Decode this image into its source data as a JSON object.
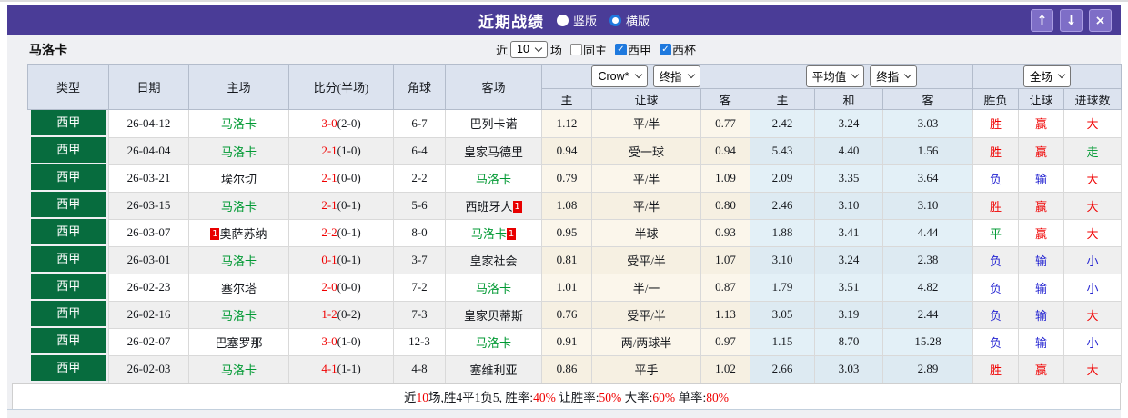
{
  "titlebar": {
    "title": "近期战绩",
    "radio_vertical": "竖版",
    "radio_horizontal": "横版",
    "selected_layout": "横版",
    "up_icon": "↑",
    "down_icon": "↓",
    "close_icon": "×"
  },
  "filterbar": {
    "team": "马洛卡",
    "recent_prefix": "近",
    "recent_value": "10",
    "recent_suffix": "场",
    "cb_same_home": "同主",
    "cb_same_home_checked": false,
    "cb_league": "西甲",
    "cb_league_checked": true,
    "cb_cup": "西杯",
    "cb_cup_checked": true,
    "check_icon": "✓"
  },
  "table": {
    "header": {
      "type": "类型",
      "date": "日期",
      "home": "主场",
      "score": "比分(半场)",
      "corner": "角球",
      "away": "客场",
      "select_crow": "Crow*",
      "select_final1": "终指",
      "select_avg": "平均值",
      "select_final2": "终指",
      "select_fulltime": "全场",
      "sub": [
        "主",
        "让球",
        "客",
        "主",
        "和",
        "客",
        "胜负",
        "让球",
        "进球数"
      ]
    },
    "rows": [
      {
        "league": "西甲",
        "date": "26-04-12",
        "home": "马洛卡",
        "home_color": "green",
        "home_badge_pre": "",
        "home_badge_post": "",
        "score_full": "3-0",
        "score_half": "(2-0)",
        "corner": "6-7",
        "away": "巴列卡诺",
        "away_color": "dark",
        "away_badge_pre": "",
        "away_badge_post": "",
        "odds_home": "1.12",
        "handicap": "平/半",
        "odds_away": "0.77",
        "avg_home": "2.42",
        "avg_draw": "3.24",
        "avg_away": "3.03",
        "result_wdl": "胜",
        "result_wdl_color": "red",
        "result_handicap": "赢",
        "result_handicap_color": "red",
        "result_goals": "大",
        "result_goals_color": "red"
      },
      {
        "league": "西甲",
        "date": "26-04-04",
        "home": "马洛卡",
        "home_color": "green",
        "home_badge_pre": "",
        "home_badge_post": "",
        "score_full": "2-1",
        "score_half": "(1-0)",
        "corner": "6-4",
        "away": "皇家马德里",
        "away_color": "dark",
        "away_badge_pre": "",
        "away_badge_post": "",
        "odds_home": "0.94",
        "handicap": "受一球",
        "odds_away": "0.94",
        "avg_home": "5.43",
        "avg_draw": "4.40",
        "avg_away": "1.56",
        "result_wdl": "胜",
        "result_wdl_color": "red",
        "result_handicap": "赢",
        "result_handicap_color": "red",
        "result_goals": "走",
        "result_goals_color": "green"
      },
      {
        "league": "西甲",
        "date": "26-03-21",
        "home": "埃尔切",
        "home_color": "dark",
        "home_badge_pre": "",
        "home_badge_post": "",
        "score_full": "2-1",
        "score_half": "(0-0)",
        "corner": "2-2",
        "away": "马洛卡",
        "away_color": "green",
        "away_badge_pre": "",
        "away_badge_post": "",
        "odds_home": "0.79",
        "handicap": "平/半",
        "odds_away": "1.09",
        "avg_home": "2.09",
        "avg_draw": "3.35",
        "avg_away": "3.64",
        "result_wdl": "负",
        "result_wdl_color": "blue",
        "result_handicap": "输",
        "result_handicap_color": "blue",
        "result_goals": "大",
        "result_goals_color": "red"
      },
      {
        "league": "西甲",
        "date": "26-03-15",
        "home": "马洛卡",
        "home_color": "green",
        "home_badge_pre": "",
        "home_badge_post": "",
        "score_full": "2-1",
        "score_half": "(0-1)",
        "corner": "5-6",
        "away": "西班牙人",
        "away_color": "dark",
        "away_badge_pre": "",
        "away_badge_post": "1",
        "odds_home": "1.08",
        "handicap": "平/半",
        "odds_away": "0.80",
        "avg_home": "2.46",
        "avg_draw": "3.10",
        "avg_away": "3.10",
        "result_wdl": "胜",
        "result_wdl_color": "red",
        "result_handicap": "赢",
        "result_handicap_color": "red",
        "result_goals": "大",
        "result_goals_color": "red"
      },
      {
        "league": "西甲",
        "date": "26-03-07",
        "home": "奥萨苏纳",
        "home_color": "dark",
        "home_badge_pre": "1",
        "home_badge_post": "",
        "score_full": "2-2",
        "score_half": "(0-1)",
        "corner": "8-0",
        "away": "马洛卡",
        "away_color": "green",
        "away_badge_pre": "",
        "away_badge_post": "1",
        "odds_home": "0.95",
        "handicap": "半球",
        "odds_away": "0.93",
        "avg_home": "1.88",
        "avg_draw": "3.41",
        "avg_away": "4.44",
        "result_wdl": "平",
        "result_wdl_color": "green",
        "result_handicap": "赢",
        "result_handicap_color": "red",
        "result_goals": "大",
        "result_goals_color": "red"
      },
      {
        "league": "西甲",
        "date": "26-03-01",
        "home": "马洛卡",
        "home_color": "green",
        "home_badge_pre": "",
        "home_badge_post": "",
        "score_full": "0-1",
        "score_half": "(0-1)",
        "corner": "3-7",
        "away": "皇家社会",
        "away_color": "dark",
        "away_badge_pre": "",
        "away_badge_post": "",
        "odds_home": "0.81",
        "handicap": "受平/半",
        "odds_away": "1.07",
        "avg_home": "3.10",
        "avg_draw": "3.24",
        "avg_away": "2.38",
        "result_wdl": "负",
        "result_wdl_color": "blue",
        "result_handicap": "输",
        "result_handicap_color": "blue",
        "result_goals": "小",
        "result_goals_color": "blue"
      },
      {
        "league": "西甲",
        "date": "26-02-23",
        "home": "塞尔塔",
        "home_color": "dark",
        "home_badge_pre": "",
        "home_badge_post": "",
        "score_full": "2-0",
        "score_half": "(0-0)",
        "corner": "7-2",
        "away": "马洛卡",
        "away_color": "green",
        "away_badge_pre": "",
        "away_badge_post": "",
        "odds_home": "1.01",
        "handicap": "半/一",
        "odds_away": "0.87",
        "avg_home": "1.79",
        "avg_draw": "3.51",
        "avg_away": "4.82",
        "result_wdl": "负",
        "result_wdl_color": "blue",
        "result_handicap": "输",
        "result_handicap_color": "blue",
        "result_goals": "小",
        "result_goals_color": "blue"
      },
      {
        "league": "西甲",
        "date": "26-02-16",
        "home": "马洛卡",
        "home_color": "green",
        "home_badge_pre": "",
        "home_badge_post": "",
        "score_full": "1-2",
        "score_half": "(0-2)",
        "corner": "7-3",
        "away": "皇家贝蒂斯",
        "away_color": "dark",
        "away_badge_pre": "",
        "away_badge_post": "",
        "odds_home": "0.76",
        "handicap": "受平/半",
        "odds_away": "1.13",
        "avg_home": "3.05",
        "avg_draw": "3.19",
        "avg_away": "2.44",
        "result_wdl": "负",
        "result_wdl_color": "blue",
        "result_handicap": "输",
        "result_handicap_color": "blue",
        "result_goals": "大",
        "result_goals_color": "red"
      },
      {
        "league": "西甲",
        "date": "26-02-07",
        "home": "巴塞罗那",
        "home_color": "dark",
        "home_badge_pre": "",
        "home_badge_post": "",
        "score_full": "3-0",
        "score_half": "(1-0)",
        "corner": "12-3",
        "away": "马洛卡",
        "away_color": "green",
        "away_badge_pre": "",
        "away_badge_post": "",
        "odds_home": "0.91",
        "handicap": "两/两球半",
        "odds_away": "0.97",
        "avg_home": "1.15",
        "avg_draw": "8.70",
        "avg_away": "15.28",
        "result_wdl": "负",
        "result_wdl_color": "blue",
        "result_handicap": "输",
        "result_handicap_color": "blue",
        "result_goals": "小",
        "result_goals_color": "blue"
      },
      {
        "league": "西甲",
        "date": "26-02-03",
        "home": "马洛卡",
        "home_color": "green",
        "home_badge_pre": "",
        "home_badge_post": "",
        "score_full": "4-1",
        "score_half": "(1-1)",
        "corner": "4-8",
        "away": "塞维利亚",
        "away_color": "dark",
        "away_badge_pre": "",
        "away_badge_post": "",
        "odds_home": "0.86",
        "handicap": "平手",
        "odds_away": "1.02",
        "avg_home": "2.66",
        "avg_draw": "3.03",
        "avg_away": "2.89",
        "result_wdl": "胜",
        "result_wdl_color": "red",
        "result_handicap": "赢",
        "result_handicap_color": "red",
        "result_goals": "大",
        "result_goals_color": "red"
      }
    ],
    "summary": {
      "parts": [
        {
          "text": "近",
          "color": "dark"
        },
        {
          "text": "10",
          "color": "red"
        },
        {
          "text": "场,胜4平1负5, 胜率:",
          "color": "dark"
        },
        {
          "text": "40%",
          "color": "red"
        },
        {
          "text": " 让胜率:",
          "color": "dark"
        },
        {
          "text": "50%",
          "color": "red"
        },
        {
          "text": " 大率:",
          "color": "dark"
        },
        {
          "text": "60%",
          "color": "red"
        },
        {
          "text": " 单率:",
          "color": "dark"
        },
        {
          "text": "80%",
          "color": "red"
        }
      ]
    }
  },
  "colors": {
    "accent_purple": "#4a3c97",
    "league_green": "#076c3e",
    "focus_team_green": "#009933",
    "win_red": "#f00000",
    "loss_blue": "#2626d2",
    "handicap_col_bg": "#fbf6eb",
    "average_col_bg": "#e3f0f7",
    "header_bg": "#dce3ef"
  }
}
